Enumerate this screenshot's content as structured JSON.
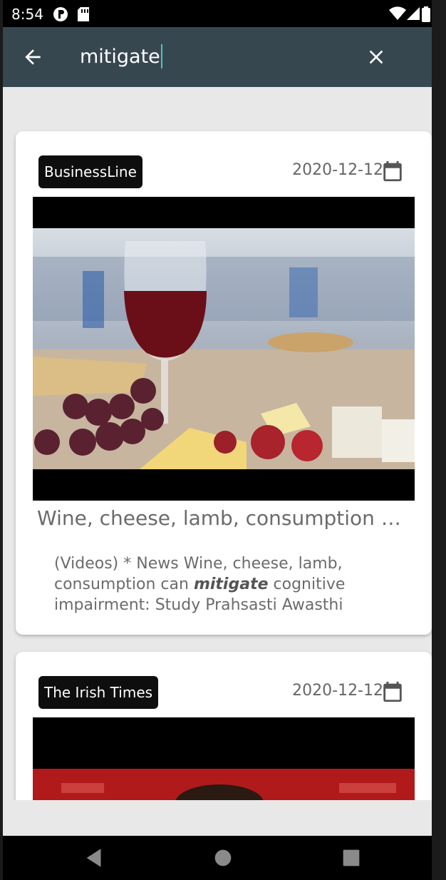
{
  "status_bar": {
    "time": "8:54"
  },
  "search": {
    "query": "mitigate"
  },
  "articles": [
    {
      "source": "BusinessLine",
      "date": "2020-12-12",
      "title": "Wine, cheese, lamb, consumption c…",
      "summary_before": "(Videos) * News Wine, cheese, lamb, consumption can ",
      "summary_highlight": "mitigate",
      "summary_after": " cognitive impairment: Study Prahsasti Awasthi"
    },
    {
      "source": "The Irish Times",
      "date": "2020-12-12"
    }
  ]
}
